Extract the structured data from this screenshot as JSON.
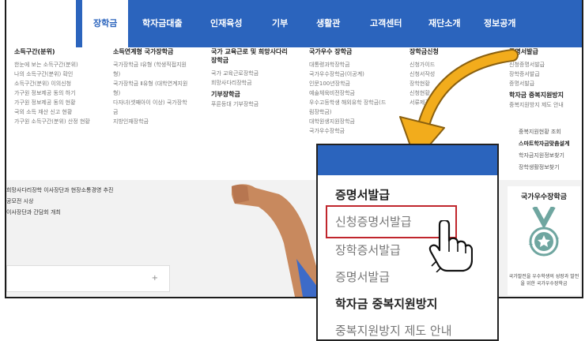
{
  "nav": {
    "items": [
      "장학금",
      "학자금대출",
      "인재육성",
      "기부",
      "생활관",
      "고객센터",
      "재단소개",
      "정보공개"
    ],
    "active_index": 0
  },
  "mega_menu": {
    "col1": {
      "title": "소득구간(분위)",
      "items": [
        "한눈에 보는 소득구간(분위)",
        "나의 소득구간(분위) 확인",
        "소득구간(분위) 이의신청",
        "가구원 정보제공 동의 하기",
        "가구원 정보제공 동의 현황",
        "국외 소득 재산 신고 현황",
        "가구원 소득구간(분위) 산정 현황"
      ]
    },
    "col2": {
      "title": "소득연계형 국가장학금",
      "items": [
        "국가장학금 Ⅰ유형 (학생직접지원형)",
        "국가장학금 Ⅱ유형 (대학연계지원형)",
        "다자녀(셋째아이 이상) 국가장학금",
        "지방인재장학금"
      ]
    },
    "col3": {
      "title": "국가 교육근로 및 희망사다리장학금",
      "items": [
        "국가 교육근로장학금",
        "희망사다리장학금"
      ],
      "sub": "기부장학금",
      "sub_items": [
        "푸른등대 기부장학금"
      ]
    },
    "col4": {
      "title": "국가우수 장학금",
      "items": [
        "대통령과학장학금",
        "국가우수장학금(이공계)",
        "인문100년장학금",
        "예술체육비전장학금",
        "우수고등학생 해외유학 장학금(드림장학금)",
        "대학원생지원장학금",
        "국가우수장학금"
      ]
    },
    "col5": {
      "title": "장학금신청",
      "items": [
        "신청가이드",
        "신청서작성",
        "장학현황",
        "신청현황",
        "서류제출"
      ]
    },
    "col6": {
      "title": "증명서발급",
      "items": [
        "신청증명서발급",
        "장학증서발급",
        "증명서발급"
      ],
      "sub": "학자금 중복지원방지",
      "sub_items": [
        "중복지원방지 제도 안내",
        "중복지원현황 조회"
      ]
    }
  },
  "right_list": {
    "items": [
      "중복지원현황 조회",
      "스마트학자금맞춤설계",
      "학자금지원정보찾기",
      "장학생활정보찾기"
    ]
  },
  "news": {
    "items": [
      "희망사다리장학 이사장단과 현장소통경영 추진",
      "공모전 시상",
      "이사장단과 간담회 개최"
    ],
    "more": "+"
  },
  "promo": {
    "title": "국가우수장학금",
    "caption": "국가발전을 우수학생의 성장과 발전을 위한 국가우수장학금"
  },
  "zoom": {
    "head1": "증명서발급",
    "item_highlight": "신청증명서발급",
    "item2": "장학증서발급",
    "item3": "증명서발급",
    "head2": "학자금 중복지원방지",
    "item4": "중복지원방지 제도 안내"
  },
  "colors": {
    "brand": "#2b64bd",
    "highlight": "#c0262c",
    "arrow": "#f2ac1c"
  },
  "icons": [
    "medal-icon",
    "pointer-hand-icon",
    "curved-arrow-icon"
  ]
}
